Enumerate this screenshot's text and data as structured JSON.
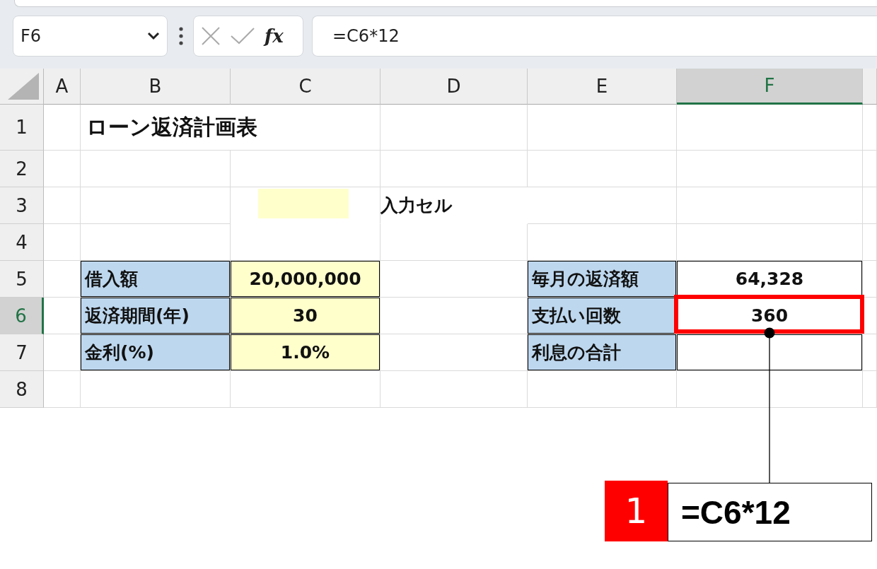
{
  "name_box": {
    "value": "F6"
  },
  "function_label": "fx",
  "formula_bar": {
    "value": "=C6*12"
  },
  "columns": [
    {
      "label": "A",
      "selected": false
    },
    {
      "label": "B",
      "selected": false
    },
    {
      "label": "C",
      "selected": false
    },
    {
      "label": "D",
      "selected": false
    },
    {
      "label": "E",
      "selected": false
    },
    {
      "label": "F",
      "selected": true
    }
  ],
  "rows": [
    {
      "label": "1",
      "selected": false,
      "cells": [
        {
          "kind": "plain"
        },
        {
          "kind": "title",
          "text": "ローン返済計画表"
        },
        {
          "kind": "plain"
        },
        {
          "kind": "plain"
        },
        {
          "kind": "plain"
        }
      ]
    },
    {
      "label": "2",
      "selected": false,
      "cells": [
        {
          "kind": "plain"
        },
        {
          "kind": "plain"
        },
        {
          "kind": "plain"
        },
        {
          "kind": "plain"
        },
        {
          "kind": "plain"
        },
        {
          "kind": "plain"
        }
      ]
    },
    {
      "label": "3",
      "selected": false,
      "cells": [
        {
          "kind": "plain"
        },
        {
          "kind": "plain"
        },
        {
          "kind": "swatch"
        },
        {
          "kind": "legend",
          "text": "入力セル"
        },
        {
          "kind": "plain"
        },
        {
          "kind": "plain"
        }
      ]
    },
    {
      "label": "4",
      "selected": false,
      "cells": [
        {
          "kind": "plain"
        },
        {
          "kind": "plain"
        },
        {
          "kind": "plain"
        },
        {
          "kind": "plain"
        },
        {
          "kind": "plain"
        },
        {
          "kind": "plain"
        }
      ]
    },
    {
      "label": "5",
      "selected": false,
      "cells": [
        {
          "kind": "plain"
        },
        {
          "kind": "label",
          "text": "借入額"
        },
        {
          "kind": "input",
          "text": "20,000,000"
        },
        {
          "kind": "plain"
        },
        {
          "kind": "label",
          "text": "毎月の返済額"
        },
        {
          "kind": "output",
          "text": "64,328"
        }
      ]
    },
    {
      "label": "6",
      "selected": true,
      "cells": [
        {
          "kind": "plain"
        },
        {
          "kind": "label",
          "text": "返済期間(年)"
        },
        {
          "kind": "input",
          "text": "30"
        },
        {
          "kind": "plain"
        },
        {
          "kind": "label",
          "text": "支払い回数"
        },
        {
          "kind": "output",
          "text": "360"
        }
      ]
    },
    {
      "label": "7",
      "selected": false,
      "cells": [
        {
          "kind": "plain"
        },
        {
          "kind": "label",
          "text": "金利(%)"
        },
        {
          "kind": "input",
          "text": "1.0%"
        },
        {
          "kind": "plain"
        },
        {
          "kind": "label",
          "text": "利息の合計"
        },
        {
          "kind": "output"
        }
      ]
    },
    {
      "label": "8",
      "selected": false,
      "cells": [
        {
          "kind": "plain"
        },
        {
          "kind": "plain"
        },
        {
          "kind": "plain"
        },
        {
          "kind": "plain"
        },
        {
          "kind": "plain"
        },
        {
          "kind": "plain"
        }
      ]
    }
  ],
  "callout": {
    "number": "1",
    "formula": "=C6*12"
  }
}
